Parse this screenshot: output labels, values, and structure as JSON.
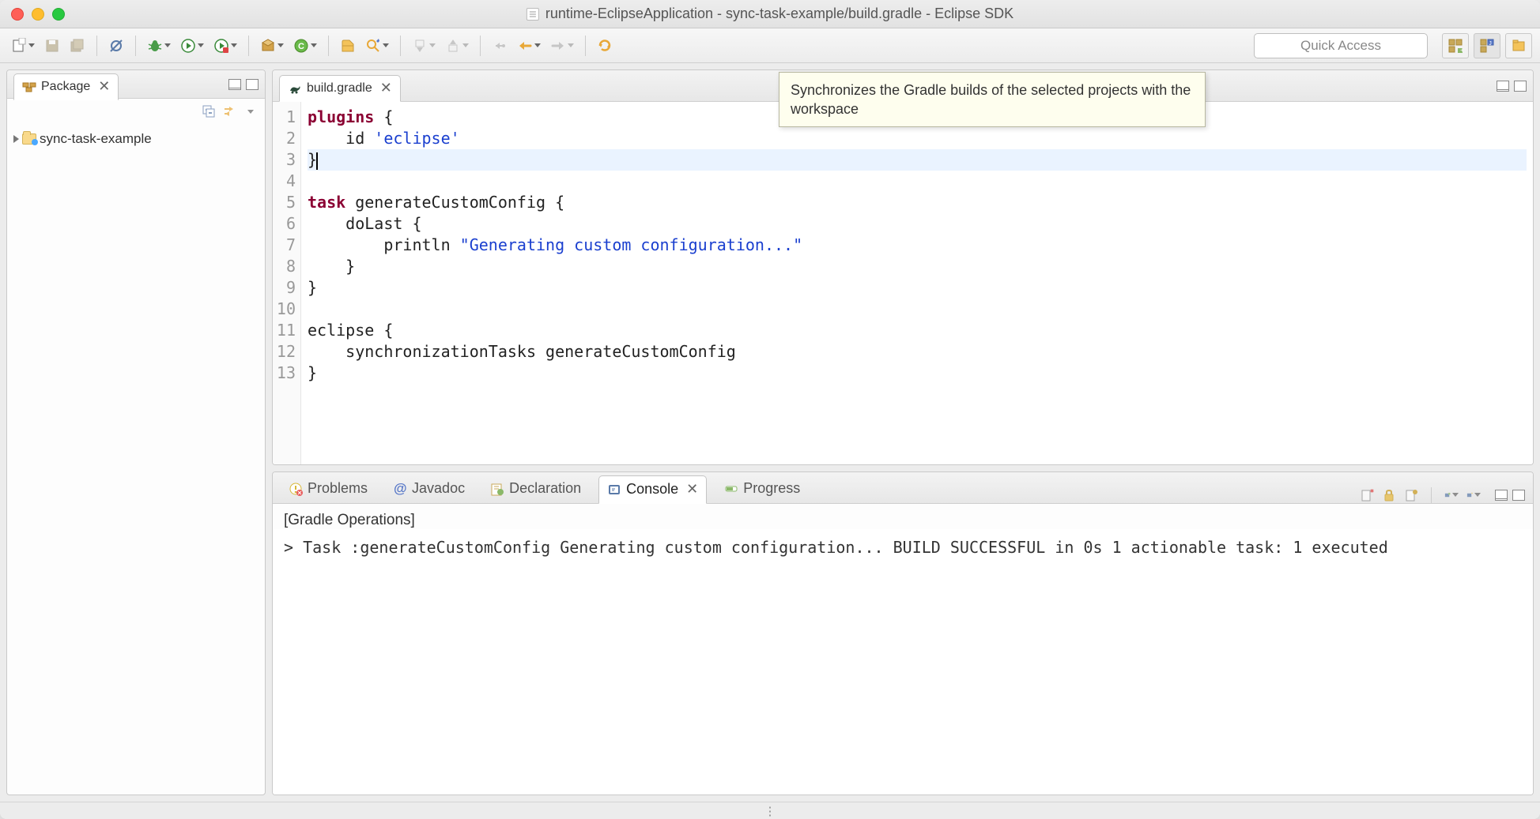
{
  "window": {
    "title": "runtime-EclipseApplication - sync-task-example/build.gradle - Eclipse SDK"
  },
  "toolbar": {
    "quick_access": "Quick Access"
  },
  "sidebar": {
    "view_title": "Package",
    "project": "sync-task-example"
  },
  "editor": {
    "tab_title": "build.gradle",
    "lines": [
      {
        "n": 1,
        "type": "code"
      },
      {
        "n": 2,
        "type": "code"
      },
      {
        "n": 3,
        "type": "hl"
      },
      {
        "n": 4,
        "type": "code"
      },
      {
        "n": 5,
        "type": "code"
      },
      {
        "n": 6,
        "type": "code"
      },
      {
        "n": 7,
        "type": "code"
      },
      {
        "n": 8,
        "type": "code"
      },
      {
        "n": 9,
        "type": "code"
      },
      {
        "n": 10,
        "type": "code"
      },
      {
        "n": 11,
        "type": "code"
      },
      {
        "n": 12,
        "type": "code"
      },
      {
        "n": 13,
        "type": "code"
      }
    ],
    "code": {
      "l1_kw": "plugins",
      "l1_rest": " {",
      "l2_pre": "    id ",
      "l2_str": "'eclipse'",
      "l3": "}",
      "l4": "",
      "l5_kw": "task",
      "l5_rest": " generateCustomConfig {",
      "l6": "    doLast {",
      "l7_pre": "        println ",
      "l7_str": "\"Generating custom configuration...\"",
      "l8": "    }",
      "l9": "}",
      "l10": "",
      "l11": "eclipse {",
      "l12": "    synchronizationTasks generateCustomConfig",
      "l13": "}"
    }
  },
  "tooltip": {
    "text": "Synchronizes the Gradle builds of the selected projects with the workspace"
  },
  "bottom": {
    "tabs": {
      "problems": "Problems",
      "javadoc": "Javadoc",
      "declaration": "Declaration",
      "console": "Console",
      "progress": "Progress"
    },
    "console_header": "[Gradle Operations]",
    "console_lines": [
      "",
      "> Task :generateCustomConfig",
      "Generating custom configuration...",
      "",
      "BUILD SUCCESSFUL in 0s",
      "1 actionable task: 1 executed"
    ]
  }
}
